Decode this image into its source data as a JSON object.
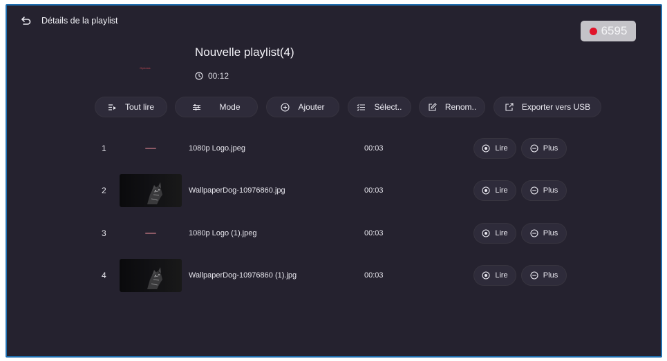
{
  "header": {
    "title": "Détails de la playlist"
  },
  "recording_badge": {
    "value": "6595",
    "dot_color": "#e0142a"
  },
  "playlist": {
    "cover_text": "Optoma",
    "name": "Nouvelle playlist(4)",
    "duration": "00:12"
  },
  "toolbar": {
    "play_all": "Tout lire",
    "mode": "Mode",
    "add": "Ajouter",
    "select": "Sélect..",
    "rename": "Renom..",
    "export": "Exporter vers USB"
  },
  "rows": [
    {
      "index": "1",
      "name": "1080p Logo.jpeg",
      "duration": "00:03",
      "play": "Lire",
      "more": "Plus"
    },
    {
      "index": "2",
      "name": "WallpaperDog-10976860.jpg",
      "duration": "00:03",
      "play": "Lire",
      "more": "Plus"
    },
    {
      "index": "3",
      "name": "1080p Logo (1).jpeg",
      "duration": "00:03",
      "play": "Lire",
      "more": "Plus"
    },
    {
      "index": "4",
      "name": "WallpaperDog-10976860 (1).jpg",
      "duration": "00:03",
      "play": "Lire",
      "more": "Plus"
    }
  ],
  "colors": {
    "background": "#25222f",
    "button": "#2e2b3a",
    "frame": "#1f6fb0"
  }
}
